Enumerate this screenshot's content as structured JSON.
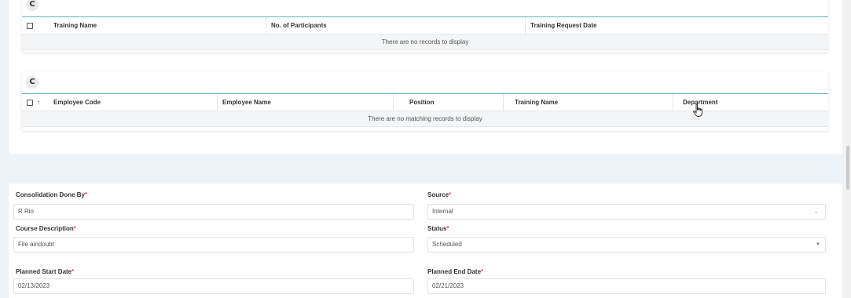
{
  "training_grid": {
    "refresh_icon": "C",
    "columns": [
      "Training Name",
      "No. of Participants",
      "Training Request Date"
    ],
    "empty_message": "There are no records to display"
  },
  "employee_grid": {
    "refresh_icon": "C",
    "sort_icon": "↑",
    "columns": [
      "Employee Code",
      "Employee Name",
      "Position",
      "Training Name",
      "Department"
    ],
    "empty_message": "There are no matching records to display"
  },
  "form": {
    "consolidation_done_by": {
      "label": "Consolidation Done By",
      "required": "*",
      "value": "R Rio"
    },
    "source": {
      "label": "Source",
      "required": "*",
      "value": "Internal"
    },
    "course_description": {
      "label": "Course Description",
      "required": "*",
      "value": "File aindoubt"
    },
    "status": {
      "label": "Status",
      "required": "*",
      "value": "Scheduled"
    },
    "planned_start_date": {
      "label": "Planned Start Date",
      "required": "*",
      "value": "02/13/2023"
    },
    "planned_end_date": {
      "label": "Planned End Date",
      "required": "*",
      "value": "02/21/2023"
    }
  },
  "icons": {
    "chevron_down": "⌄",
    "caret_down": "▼",
    "cursor": "hand-pointer-icon"
  },
  "colors": {
    "header_underline": "#5fb3b3",
    "required": "#e05353",
    "page_bg": "#eef3f7"
  }
}
